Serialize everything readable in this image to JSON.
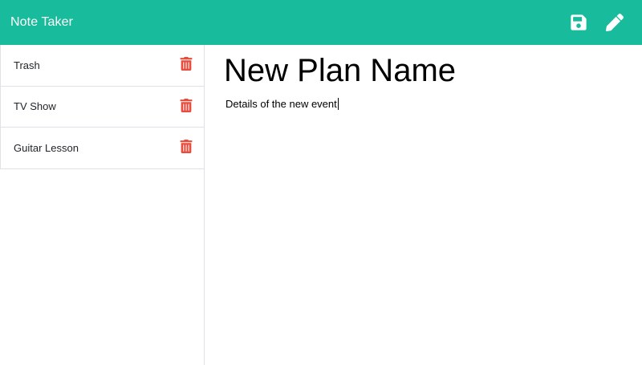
{
  "navbar": {
    "brand": "Note Taker",
    "color": "#18bc9c",
    "save_icon": "save-icon",
    "new_icon": "pencil-icon"
  },
  "notes": [
    {
      "title": "Trash",
      "delete_icon": "trash-icon"
    },
    {
      "title": "TV Show",
      "delete_icon": "trash-icon"
    },
    {
      "title": "Guitar Lesson",
      "delete_icon": "trash-icon"
    }
  ],
  "editor": {
    "title": "New Plan Name",
    "body": "Details of the new event"
  },
  "colors": {
    "delete": "#e74c3c",
    "border": "#dee2e6"
  }
}
